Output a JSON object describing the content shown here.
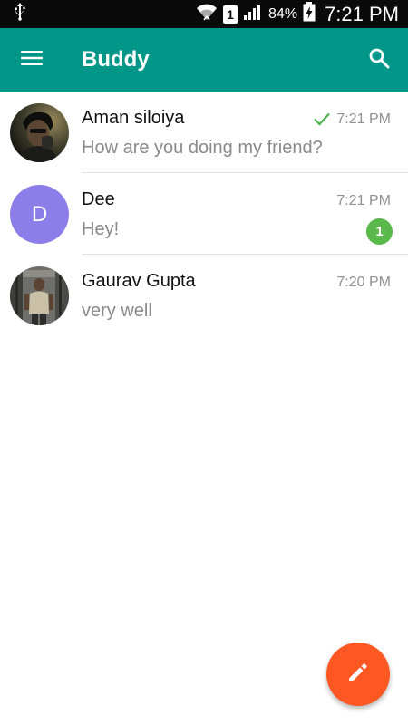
{
  "status_bar": {
    "battery": "84%",
    "sim_slot": "1",
    "time": "7:21 PM"
  },
  "app_bar": {
    "title": "Buddy",
    "color": "#009688"
  },
  "conversations": [
    {
      "name": "Aman siloiya",
      "snippet": "How are you doing my friend?",
      "time": "7:21 PM",
      "read_receipt": true,
      "avatar": "photo"
    },
    {
      "name": "Dee",
      "snippet": "Hey!",
      "time": "7:21 PM",
      "unread_count": "1",
      "avatar_letter": "D",
      "avatar_color": "#8c7ee9"
    },
    {
      "name": "Gaurav Gupta",
      "snippet": "very well",
      "time": "7:20 PM",
      "avatar": "photo"
    }
  ],
  "fab": {
    "icon": "pencil-icon",
    "color": "#ff5722"
  },
  "accent_colors": {
    "read_check": "#4caf50",
    "unread_badge": "#5ab94b"
  }
}
